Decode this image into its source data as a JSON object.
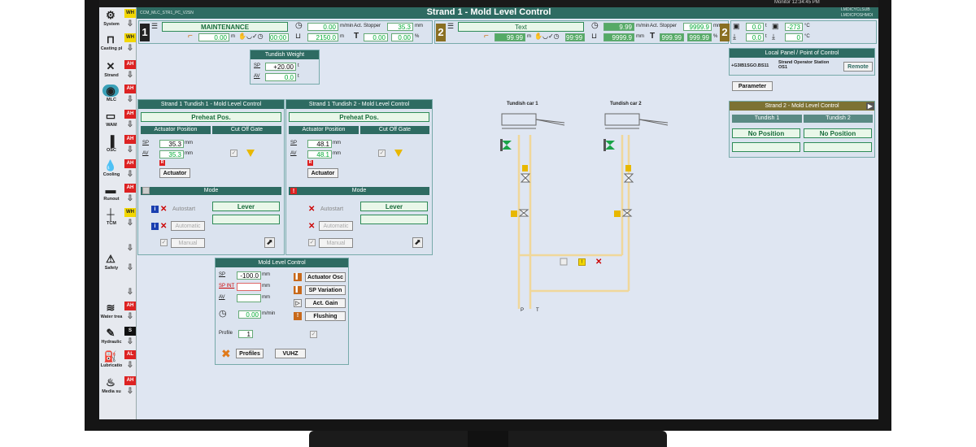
{
  "header": {
    "title": "Strand 1 - Mold Level Control",
    "left_code": "CCM_MLC_STR1_PC_V2SN",
    "right_codes": [
      "LMDICYCLSUB",
      "LMDICPOSHMOI"
    ],
    "top_right_text": "Monitor 12:34:45 PM"
  },
  "sidebar": [
    {
      "name": "system",
      "label": "System",
      "icon": "⚙",
      "alarm": "WH",
      "alarm_type": "wh"
    },
    {
      "name": "casting",
      "label": "Casting pl",
      "icon": "⊓",
      "alarm": "WH",
      "alarm_type": "wh"
    },
    {
      "name": "strand",
      "label": "Strand",
      "icon": "✕",
      "alarm": "AH",
      "alarm_type": "ah"
    },
    {
      "name": "mlc",
      "label": "MLC",
      "icon": "◉",
      "alarm": "AH",
      "alarm_type": "ah",
      "active": true
    },
    {
      "name": "wam",
      "label": "WAM",
      "icon": "▭",
      "alarm": "AH",
      "alarm_type": "ah"
    },
    {
      "name": "osc",
      "label": "OSC",
      "icon": "▐",
      "alarm": "AH",
      "alarm_type": "ah"
    },
    {
      "name": "cooling",
      "label": "Cooling",
      "icon": "💧",
      "alarm": "AH",
      "alarm_type": "ah"
    },
    {
      "name": "runout",
      "label": "Runout",
      "icon": "▬",
      "alarm": "AH",
      "alarm_type": "ah"
    },
    {
      "name": "tcm",
      "label": "TCM",
      "icon": "┼",
      "alarm": "WH",
      "alarm_type": "wh"
    },
    {
      "name": "blank1",
      "label": "",
      "icon": "",
      "alarm": "",
      "alarm_type": "none"
    },
    {
      "name": "safety",
      "label": "Safety",
      "icon": "⚠",
      "alarm": "",
      "alarm_type": "none"
    },
    {
      "name": "blank2",
      "label": "",
      "icon": "",
      "alarm": "",
      "alarm_type": "none"
    },
    {
      "name": "water",
      "label": "Water trea",
      "icon": "≋",
      "alarm": "AH",
      "alarm_type": "ah"
    },
    {
      "name": "hydraulic",
      "label": "Hydraulic",
      "icon": "✎",
      "alarm": "S",
      "alarm_type": "s"
    },
    {
      "name": "lubrication",
      "label": "Lubricatio",
      "icon": "⛽",
      "alarm": "AL",
      "alarm_type": "ah"
    },
    {
      "name": "media",
      "label": "Media su",
      "icon": "♨",
      "alarm": "AH",
      "alarm_type": "ah"
    }
  ],
  "strand_bar_1": {
    "number": "1",
    "status": "MAINTENANCE",
    "speed": "0.00",
    "speed_unit": "m/min",
    "act_stopper_label": "Act. Stopper",
    "act_stopper": "35.3",
    "act_stopper_unit": "mm",
    "len": "0.00",
    "len_unit": "m",
    "time": "00:00",
    "weight": "2150.0",
    "weight_unit": "m",
    "temp": "0.00",
    "temp2": "0.00",
    "pct": "%"
  },
  "strand_bar_2": {
    "number": "2",
    "status": "Text",
    "speed": "9.99",
    "speed_unit": "m/min",
    "act_stopper_label": "Act. Stopper",
    "act_stopper": "9999.9",
    "act_stopper_unit": "mm",
    "len": "99.99",
    "len_unit": "m",
    "time": "99:99",
    "weight": "9999.9",
    "weight_unit": "mm",
    "temp": "999.99",
    "temp2": "999.99",
    "pct": "%"
  },
  "strand_bar_3": {
    "number": "2",
    "v1": "0.0",
    "u1": "t",
    "v2": "-273",
    "u2": "°C",
    "v3": "0.0",
    "u3": "t",
    "v4": "0",
    "u4": "°C"
  },
  "tundish_weight": {
    "title": "Tundish Weight",
    "sp_label": "SP",
    "sp": "+20.00",
    "av_label": "AV",
    "av": "0.0",
    "unit": "t"
  },
  "tundish1": {
    "title": "Strand 1 Tundish 1 - Mold Level Control",
    "status": "Preheat Pos.",
    "actuator_position": "Actuator Position",
    "cut_off_gate": "Cut Off Gate",
    "sp_label": "SP",
    "sp": "35.3",
    "av_label": "AV",
    "av": "35.3",
    "unit": "mm",
    "actuator_btn": "Actuator",
    "mode_title": "Mode",
    "autostart": "Autostart",
    "automatic": "Automatic",
    "manual": "Manual",
    "lever": "Lever"
  },
  "tundish2": {
    "title": "Strand 1 Tundish 2 - Mold Level Control",
    "status": "Preheat Pos.",
    "actuator_position": "Actuator Position",
    "cut_off_gate": "Cut Off Gate",
    "sp_label": "SP",
    "sp": "48.1",
    "av_label": "AV",
    "av": "48.1",
    "unit": "mm",
    "actuator_btn": "Actuator",
    "mode_title": "Mode",
    "autostart": "Autostart",
    "automatic": "Automatic",
    "manual": "Manual",
    "lever": "Lever"
  },
  "mlc": {
    "title": "Mold Level Control",
    "sp_label": "SP",
    "sp": "-100.0",
    "spint_label": "SP INT",
    "spint": "",
    "av_label": "AV",
    "av": "",
    "unit": "mm",
    "speed": "0.00",
    "speed_unit": "m/min",
    "profile_label": "Profile",
    "profile": "1",
    "actuator_osc": "Actuator Osc",
    "sp_variation": "SP Variation",
    "act_gain": "Act. Gain",
    "flushing": "Flushing",
    "profiles_btn": "Profiles",
    "vuhz_btn": "VUHZ"
  },
  "diagram": {
    "car1": "Tundish car 1",
    "car2": "Tundish car 2",
    "p_label": "P",
    "t_label": "T"
  },
  "local_panel": {
    "title": "Local Panel / Point of Control",
    "code": "+G3IB1SGO.BS11",
    "station": "Strand Operator Station OS1",
    "remote_btn": "Remote",
    "parameter_btn": "Parameter"
  },
  "strand2_panel": {
    "title": "Strand 2 - Mold Level Control",
    "tundish1": "Tundish 1",
    "tundish2": "Tundish 2",
    "no_pos1": "No Position",
    "no_pos2": "No Position"
  },
  "colors": {
    "teal": "#2e6b62",
    "alarm_red": "#d22",
    "alarm_yellow": "#f2d700",
    "valve_yellow": "#e8b800",
    "pipe": "#f0d79a"
  }
}
